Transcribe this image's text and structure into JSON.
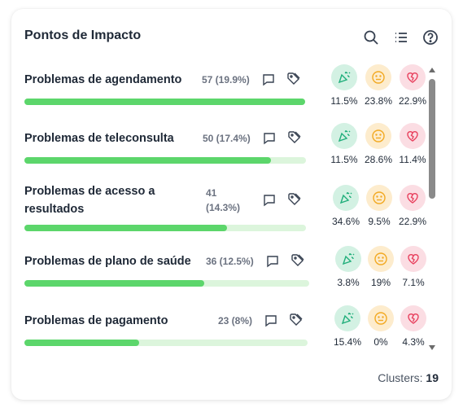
{
  "panel": {
    "title": "Pontos de Impacto",
    "icons": [
      "search-icon",
      "list-icon",
      "help-icon"
    ]
  },
  "rows": [
    {
      "name": "Problemas de agendamento",
      "count": "57 (19.9%)",
      "progress": 1.0,
      "pos": "11.5%",
      "neu": "23.8%",
      "neg": "22.9%"
    },
    {
      "name": "Problemas de teleconsulta",
      "count": "50 (17.4%)",
      "progress": 0.877,
      "pos": "11.5%",
      "neu": "28.6%",
      "neg": "11.4%"
    },
    {
      "name_line1": "Problemas de acesso a",
      "name_line2": "resultados",
      "count_line1": "41",
      "count_line2": "(14.3%)",
      "progress": 0.719,
      "pos": "34.6%",
      "neu": "9.5%",
      "neg": "22.9%"
    },
    {
      "name": "Problemas de plano de saúde",
      "count": "36 (12.5%)",
      "progress": 0.632,
      "pos": "3.8%",
      "neu": "19%",
      "neg": "7.1%"
    },
    {
      "name": "Problemas de pagamento",
      "count": "23 (8%)",
      "progress": 0.404,
      "pos": "15.4%",
      "neu": "0%",
      "neg": "4.3%"
    }
  ],
  "colors": {
    "bar": "#5cd66b",
    "track": "#dcf5dc",
    "positive": "#1fae7a",
    "neutral": "#f2a922",
    "negative": "#e8425f"
  },
  "footer": {
    "label": "Clusters:",
    "value": "19"
  }
}
